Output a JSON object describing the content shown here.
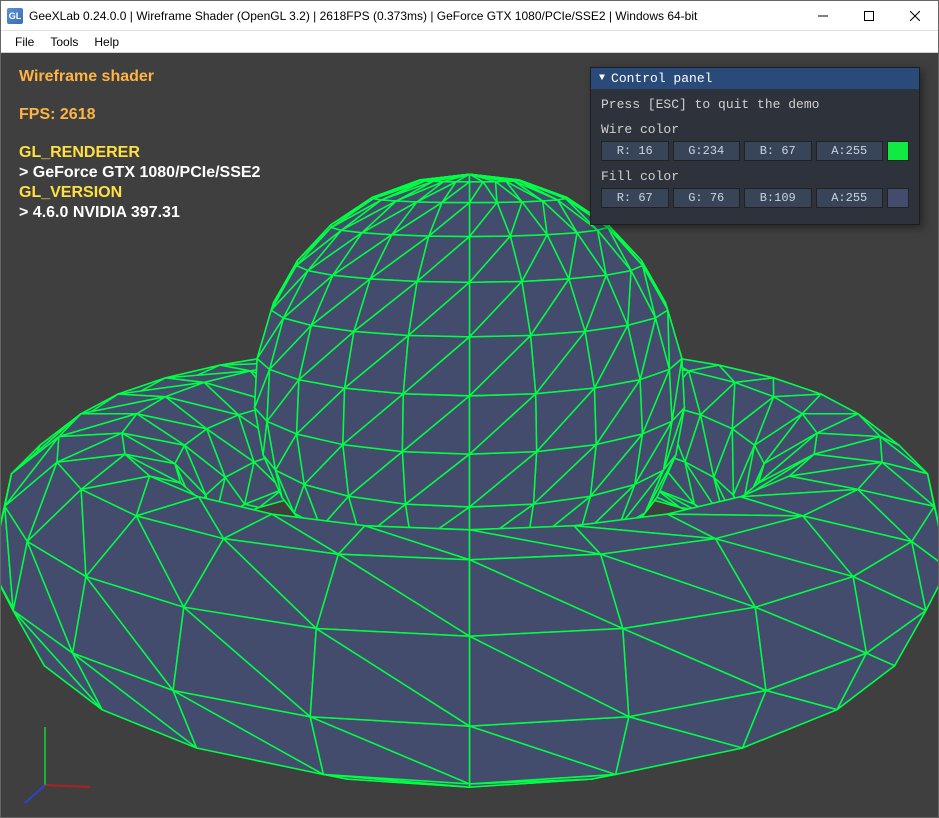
{
  "window": {
    "title": "GeeXLab 0.24.0.0 | Wireframe Shader (OpenGL 3.2) | 2618FPS (0.373ms) | GeForce GTX 1080/PCIe/SSE2 | Windows 64-bit"
  },
  "menu": {
    "file": "File",
    "tools": "Tools",
    "help": "Help"
  },
  "overlay": {
    "title": "Wireframe shader",
    "fps_label": "FPS: 2618",
    "gl_renderer_label": "GL_RENDERER",
    "gl_renderer_value": "> GeForce GTX 1080/PCIe/SSE2",
    "gl_version_label": "GL_VERSION",
    "gl_version_value": "> 4.6.0 NVIDIA 397.31"
  },
  "panel": {
    "title": "Control panel",
    "instruction": "Press [ESC] to quit the demo",
    "wire_label": "Wire color",
    "wire": {
      "r": "R: 16",
      "g": "G:234",
      "b": "B: 67",
      "a": "A:255",
      "swatch": "#10ea43"
    },
    "fill_label": "Fill color",
    "fill": {
      "r": "R: 67",
      "g": "G: 76",
      "b": "B:109",
      "a": "A:255",
      "swatch": "#434c6d"
    }
  },
  "colors": {
    "wire": "#00ff44",
    "fill": "#434c6d",
    "viewport_bg": "#3f3f3f"
  }
}
